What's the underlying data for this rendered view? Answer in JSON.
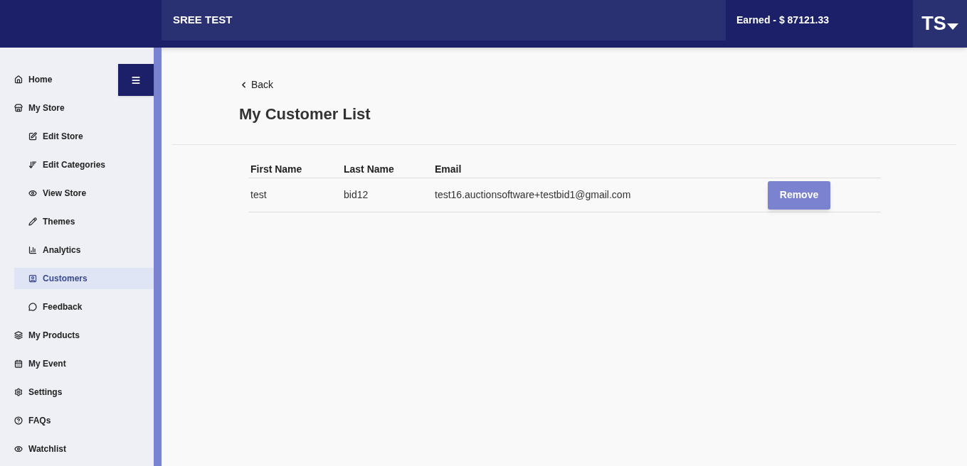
{
  "header": {
    "title": "SREE TEST",
    "earned": "Earned - $ 87121.33",
    "avatar": "TS"
  },
  "sidebar": {
    "items": [
      {
        "label": "Home",
        "selected": false
      },
      {
        "label": "My Store",
        "selected": false,
        "children": [
          {
            "label": "Edit Store",
            "selected": false
          },
          {
            "label": "Edit Categories",
            "selected": false
          },
          {
            "label": "View Store",
            "selected": false
          },
          {
            "label": "Themes",
            "selected": false
          },
          {
            "label": "Analytics",
            "selected": false
          },
          {
            "label": "Customers",
            "selected": true
          },
          {
            "label": "Feedback",
            "selected": false
          }
        ]
      },
      {
        "label": "My Products",
        "selected": false
      },
      {
        "label": "My Event",
        "selected": false
      },
      {
        "label": "Settings",
        "selected": false
      },
      {
        "label": "FAQs",
        "selected": false
      },
      {
        "label": "Watchlist",
        "selected": false
      }
    ]
  },
  "back": "Back",
  "page_title": "My Customer List",
  "table": {
    "columns": [
      "First Name",
      "Last Name",
      "Email"
    ],
    "rows": [
      {
        "cells": [
          "test",
          "bid12",
          "test16.auctionsoftware+testbid1@gmail.com"
        ],
        "action": "Remove"
      }
    ]
  }
}
